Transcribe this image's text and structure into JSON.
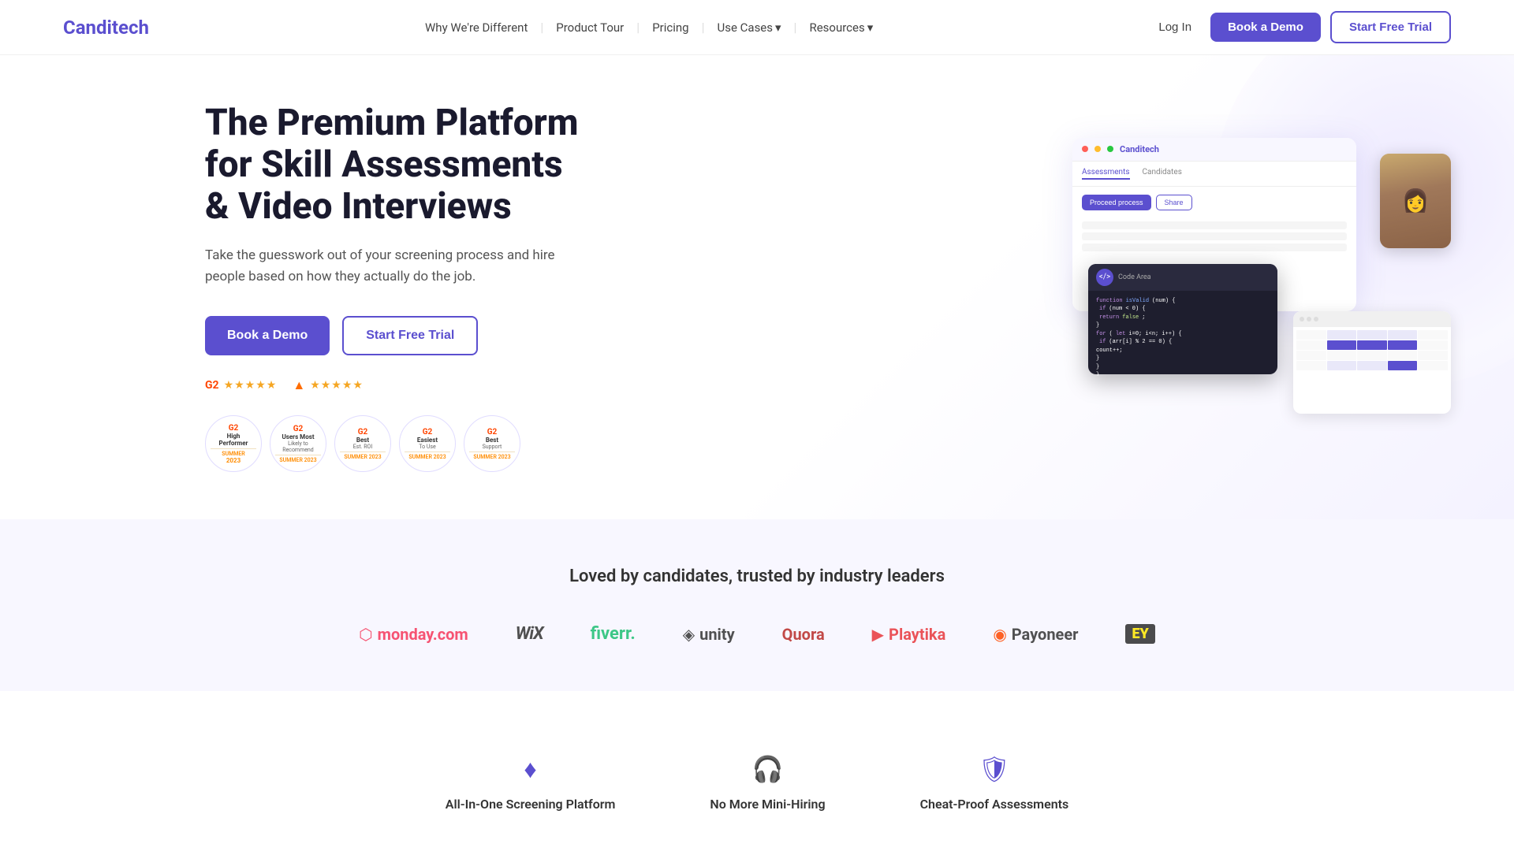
{
  "brand": {
    "name": "Canditech"
  },
  "nav": {
    "links": [
      {
        "id": "why-different",
        "label": "Why We're Different",
        "has_dropdown": false
      },
      {
        "id": "product-tour",
        "label": "Product Tour",
        "has_dropdown": false
      },
      {
        "id": "pricing",
        "label": "Pricing",
        "has_dropdown": false
      },
      {
        "id": "use-cases",
        "label": "Use Cases",
        "has_dropdown": true
      },
      {
        "id": "resources",
        "label": "Resources",
        "has_dropdown": true
      }
    ],
    "login_label": "Log In",
    "demo_label": "Book a Demo",
    "trial_label": "Start Free Trial"
  },
  "hero": {
    "title": "The Premium Platform for Skill Assessments & Video Interviews",
    "subtitle": "Take the guesswork out of your screening process and hire people based on how they actually do the job.",
    "cta_demo": "Book a Demo",
    "cta_trial": "Start Free Trial",
    "g2_stars": "★★★★★",
    "capterra_stars": "★★★★★",
    "badges": [
      {
        "id": "high-performer",
        "title": "High Performer",
        "sub": "",
        "season": "SUMMER",
        "year": "2023"
      },
      {
        "id": "most-likely",
        "title": "Users Most Likely to Recommend",
        "sub": "",
        "season": "SUMMER",
        "year": "2023"
      },
      {
        "id": "best-roi",
        "title": "Best Est. ROI",
        "sub": "",
        "season": "SUMMER",
        "year": "2023"
      },
      {
        "id": "easiest-use",
        "title": "Easiest To Use",
        "sub": "",
        "season": "SUMMER",
        "year": "2023"
      },
      {
        "id": "best-support",
        "title": "Best Support",
        "sub": "",
        "season": "SUMMER",
        "year": "2023"
      }
    ],
    "ui_window": {
      "logo": "Canditech",
      "tabs": [
        "Assessments",
        "Candidates"
      ],
      "actions": [
        "Proceed process",
        "Share"
      ]
    },
    "code_window": {
      "title": "Code Area",
      "icon": "</>",
      "lines": [
        "function isValid(num) {",
        "  if (num < 0) {",
        "    return false;",
        "  }",
        "  for (let i=0; i<n; i++) {",
        "    if (arr[i] % 2 == 0) {",
        "      count++;",
        "    }",
        "  }",
        "}"
      ]
    }
  },
  "trusted": {
    "title": "Loved by candidates, trusted by industry leaders",
    "logos": [
      {
        "id": "monday",
        "text": "monday.com",
        "class": "logo-monday"
      },
      {
        "id": "wix",
        "text": "WiX",
        "class": "logo-wix"
      },
      {
        "id": "fiverr",
        "text": "fiverr.",
        "class": "logo-fiverr"
      },
      {
        "id": "unity",
        "text": "unity",
        "class": "logo-unity"
      },
      {
        "id": "quora",
        "text": "Quora",
        "class": "logo-quora"
      },
      {
        "id": "playtika",
        "text": "Playtika",
        "class": "logo-playtika"
      },
      {
        "id": "payoneer",
        "text": "Payoneer",
        "class": "logo-payoneer"
      },
      {
        "id": "ey",
        "text": "EY",
        "class": "logo-ey"
      }
    ]
  },
  "features": {
    "items": [
      {
        "id": "all-in-one",
        "icon": "diamond",
        "label": "All-In-One Screening Platform"
      },
      {
        "id": "no-more",
        "icon": "headset",
        "label": "No More Mini-Hiring"
      },
      {
        "id": "cheat-proof",
        "icon": "shield",
        "label": "Cheat-Proof Assessments"
      }
    ]
  },
  "colors": {
    "primary": "#5b4fcf",
    "text_dark": "#1a1a2e",
    "text_medium": "#555",
    "bg_light": "#f8f7ff"
  }
}
